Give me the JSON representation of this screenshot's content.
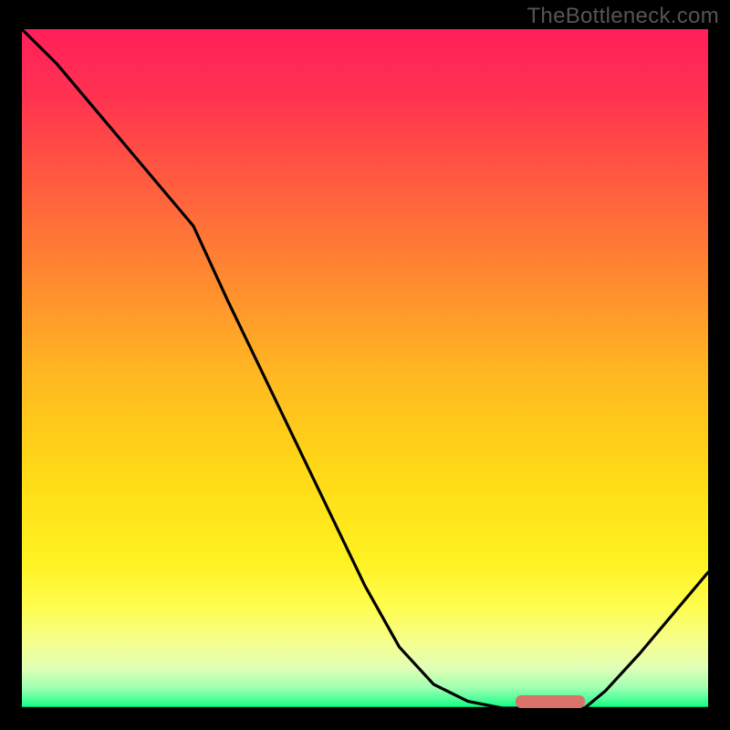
{
  "watermark": "TheBottleneck.com",
  "chart_data": {
    "type": "line",
    "x": [
      0,
      5,
      10,
      15,
      20,
      25,
      30,
      35,
      40,
      45,
      50,
      55,
      60,
      65,
      70,
      72,
      76,
      80,
      82,
      85,
      90,
      95,
      100
    ],
    "values": [
      100,
      95,
      89,
      83,
      77,
      71,
      60,
      49.5,
      39,
      28.5,
      18,
      9,
      3.5,
      1,
      0,
      0,
      0,
      0,
      0,
      2.5,
      8,
      14,
      20
    ],
    "title": "",
    "xlabel": "",
    "ylabel": "",
    "xlim": [
      0,
      100
    ],
    "ylim": [
      0,
      100
    ],
    "marker_segment": {
      "start_pct": 72,
      "end_pct": 82
    },
    "background_gradient": [
      {
        "pos": 0.0,
        "color": "#ff1f5a"
      },
      {
        "pos": 0.1,
        "color": "#ff3350"
      },
      {
        "pos": 0.22,
        "color": "#ff5a40"
      },
      {
        "pos": 0.35,
        "color": "#ff8432"
      },
      {
        "pos": 0.5,
        "color": "#ffb522"
      },
      {
        "pos": 0.65,
        "color": "#ffd916"
      },
      {
        "pos": 0.78,
        "color": "#fff120"
      },
      {
        "pos": 0.85,
        "color": "#fffd4e"
      },
      {
        "pos": 0.9,
        "color": "#f6ff8a"
      },
      {
        "pos": 0.94,
        "color": "#e2ffb6"
      },
      {
        "pos": 0.97,
        "color": "#a0ffb2"
      },
      {
        "pos": 0.99,
        "color": "#3eff93"
      },
      {
        "pos": 1.0,
        "color": "#00ff85"
      }
    ]
  }
}
